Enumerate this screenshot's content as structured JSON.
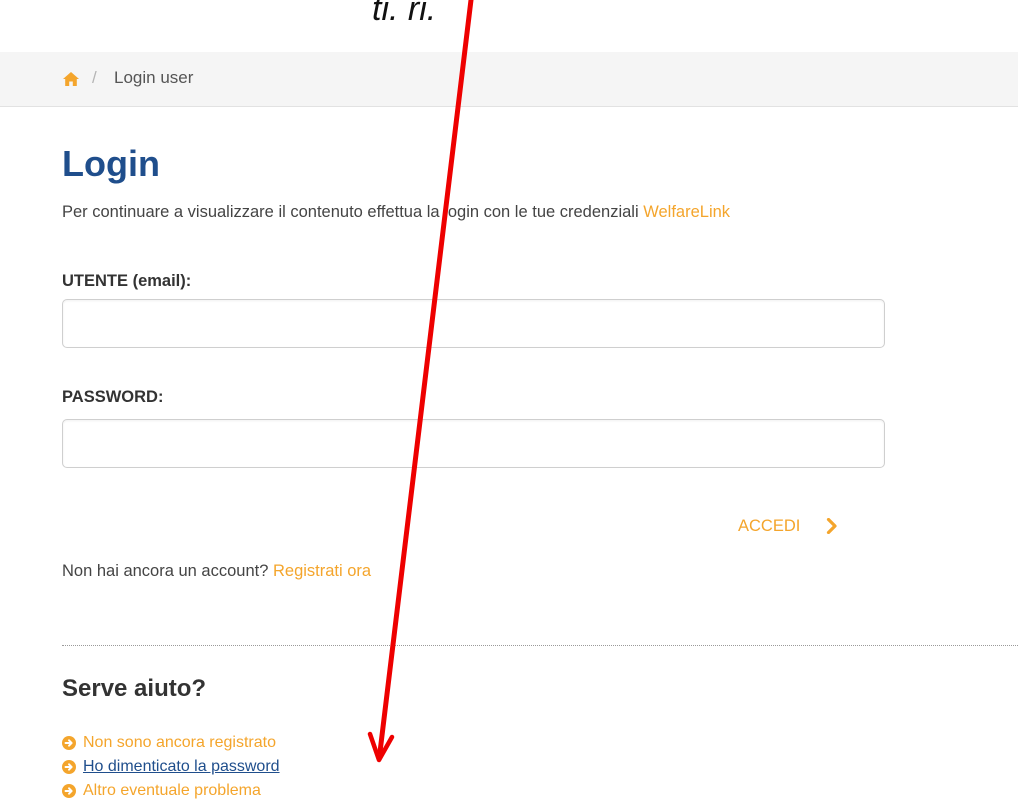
{
  "header_text": "ti.                         ri.",
  "breadcrumb": {
    "current": "Login user",
    "separator": "/"
  },
  "page": {
    "title": "Login",
    "intro_text": "Per continuare a visualizzare il contenuto effettua la login con le tue credenziali ",
    "intro_link": "WelfareLink"
  },
  "form": {
    "user_label": "UTENTE (email):",
    "user_value": "",
    "password_label": "PASSWORD:",
    "password_value": "",
    "submit_label": "ACCEDI"
  },
  "register": {
    "prompt": "Non hai ancora un account? ",
    "link": "Registrati ora"
  },
  "help": {
    "title": "Serve aiuto?",
    "items": [
      {
        "label": "Non sono ancora registrato"
      },
      {
        "label": "Ho dimenticato la password"
      },
      {
        "label": "Altro eventuale problema"
      }
    ]
  },
  "colors": {
    "accent": "#f4a52c",
    "title_blue": "#1f4e8c",
    "annotation_red": "#ee0000"
  }
}
